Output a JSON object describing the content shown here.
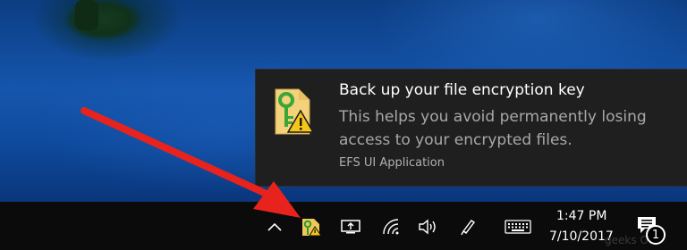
{
  "notification": {
    "title": "Back up your file encryption key",
    "body": "This helps you avoid permanently losing access to your encrypted files.",
    "app_name": "EFS UI Application",
    "icon": "efs-key-warning-icon"
  },
  "taskbar": {
    "tray_icons": [
      "chevron-up-icon",
      "efs-key-warning-icon",
      "project-display-icon",
      "wifi-icon",
      "volume-icon",
      "pen-ink-icon",
      "keyboard-icon"
    ],
    "clock": {
      "time": "1:47 PM",
      "date": "7/10/2017"
    },
    "action_center": {
      "icon": "action-center-icon",
      "badge": "1"
    }
  },
  "watermark": "geeks OF",
  "colors": {
    "toast_bg": "#1f1f1f",
    "taskbar_bg": "#0b0b0b",
    "arrow": "#e8231d",
    "desktop": "#0d3e86"
  }
}
